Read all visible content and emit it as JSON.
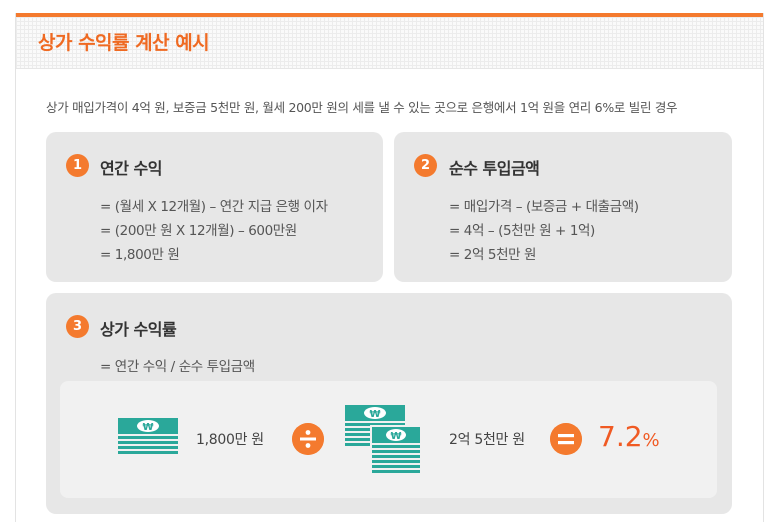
{
  "title": "상가 수익률 계산 예시",
  "intro": "상가 매입가격이 4억 원, 보증금 5천만 원, 월세 200만 원의 세를 낼 수 있는 곳으로 은행에서 1억 원을 연리 6%로 빌린 경우",
  "cards": [
    {
      "number": "1",
      "title": "연간 수익",
      "lines": [
        "= (월세 X 12개월) – 연간 지급 은행 이자",
        "= (200만 원 X 12개월) – 600만원",
        "= 1,800만 원"
      ]
    },
    {
      "number": "2",
      "title": "순수 투입금액",
      "lines": [
        "= 매입가격 – (보증금 + 대출금액)",
        "= 4억 – (5천만 원 + 1억)",
        "= 2억 5천만 원"
      ]
    },
    {
      "number": "3",
      "title": "상가 수익률",
      "lines": [
        "= 연간 수익 / 순수 투입금액"
      ]
    }
  ],
  "formula": {
    "annual_income": "1,800만 원",
    "investment": "2억 5천만 원",
    "result_value": "7.2",
    "result_unit": "%",
    "currency_symbol": "₩"
  },
  "colors": {
    "accent": "#f47a2e",
    "bill": "#2aa89a"
  },
  "icons": {
    "divide": "divide-icon",
    "equals": "equals-icon",
    "money": "banknote-icon"
  }
}
